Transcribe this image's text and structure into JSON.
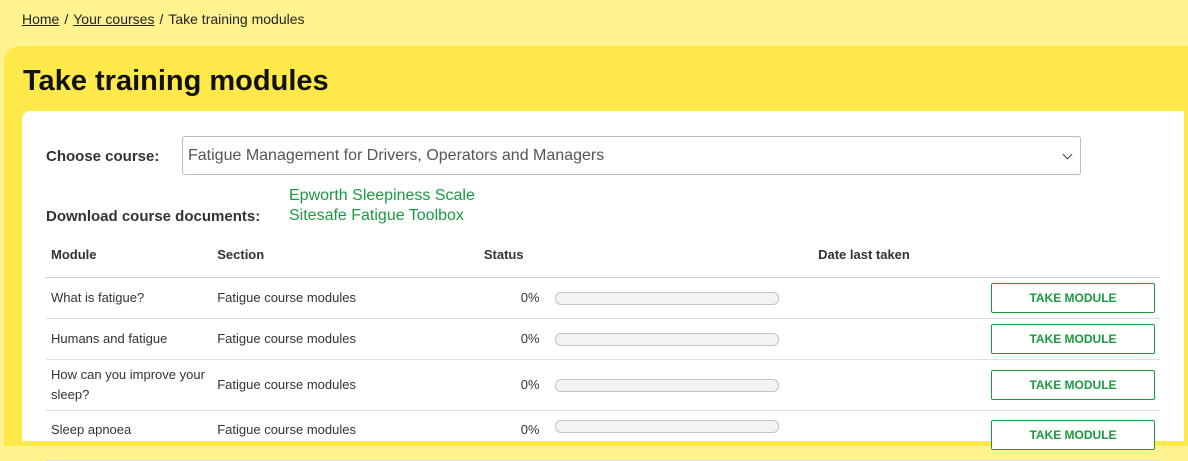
{
  "breadcrumb": {
    "items": [
      {
        "label": "Home",
        "link": true
      },
      {
        "label": "Your courses",
        "link": true
      },
      {
        "label": "Take training modules",
        "link": false
      }
    ],
    "separator": "/"
  },
  "page": {
    "title": "Take training modules"
  },
  "course": {
    "label": "Choose course:",
    "selected": "Fatigue Management for Drivers, Operators and Managers"
  },
  "documents": {
    "label": "Download course documents:",
    "links": [
      "Epworth Sleepiness Scale",
      "Sitesafe Fatigue Toolbox"
    ]
  },
  "table": {
    "headers": {
      "module": "Module",
      "section": "Section",
      "status": "Status",
      "date": "Date last taken"
    },
    "rows": [
      {
        "module": "What is fatigue?",
        "section": "Fatigue course modules",
        "status": "0%",
        "progress": 0,
        "date": "",
        "button": "TAKE MODULE"
      },
      {
        "module": "Humans and fatigue",
        "section": "Fatigue course modules",
        "status": "0%",
        "progress": 0,
        "date": "",
        "button": "TAKE MODULE"
      },
      {
        "module": "How can you improve your sleep?",
        "section": "Fatigue course modules",
        "status": "0%",
        "progress": 0,
        "date": "",
        "button": "TAKE MODULE"
      },
      {
        "module": "Sleep apnoea",
        "section": "Fatigue course modules",
        "status": "0%",
        "progress": 0,
        "date": "",
        "button": "TAKE MODULE"
      }
    ]
  },
  "colors": {
    "page_background": "#fff38f",
    "panel": "#ffe94a",
    "accent_green": "#1a9a3f"
  }
}
